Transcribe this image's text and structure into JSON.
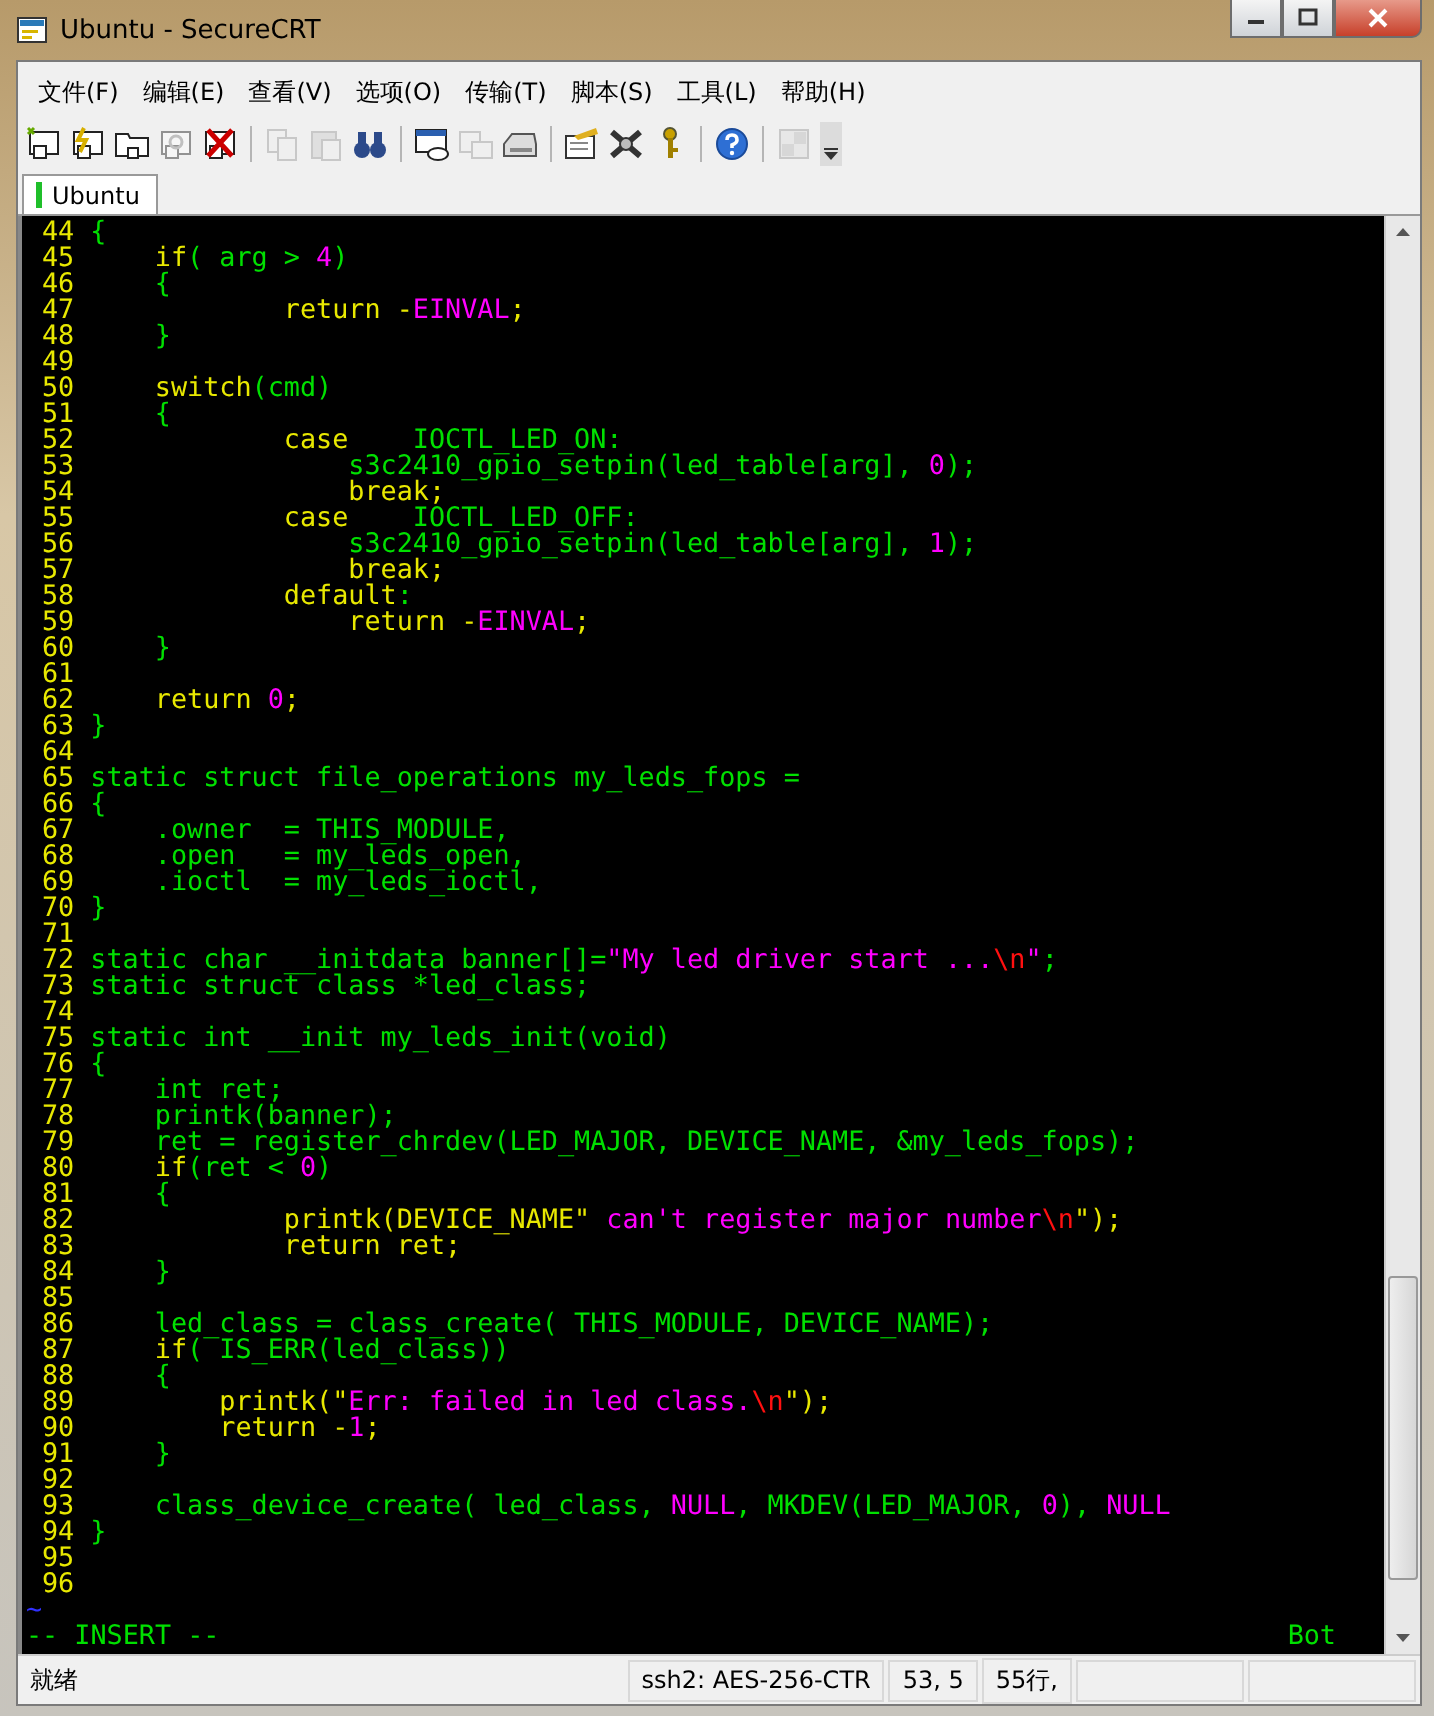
{
  "window": {
    "title": "Ubuntu - SecureCRT"
  },
  "menu": [
    "文件(F)",
    "编辑(E)",
    "查看(V)",
    "选项(O)",
    "传输(T)",
    "脚本(S)",
    "工具(L)",
    "帮助(H)"
  ],
  "toolbar": [
    {
      "kind": "connect",
      "disabled": false
    },
    {
      "kind": "quick-connect",
      "disabled": false
    },
    {
      "kind": "folder",
      "disabled": false
    },
    {
      "kind": "reconnect",
      "disabled": true
    },
    {
      "kind": "disconnect",
      "disabled": false
    },
    {
      "kind": "sep"
    },
    {
      "kind": "copy",
      "disabled": true
    },
    {
      "kind": "paste",
      "disabled": true
    },
    {
      "kind": "find",
      "disabled": false
    },
    {
      "kind": "sep"
    },
    {
      "kind": "window",
      "disabled": false
    },
    {
      "kind": "log",
      "disabled": true
    },
    {
      "kind": "print",
      "disabled": false
    },
    {
      "kind": "sep"
    },
    {
      "kind": "options",
      "disabled": false
    },
    {
      "kind": "tools",
      "disabled": false
    },
    {
      "kind": "key",
      "disabled": false
    },
    {
      "kind": "sep"
    },
    {
      "kind": "help",
      "disabled": false
    },
    {
      "kind": "sep"
    },
    {
      "kind": "map",
      "disabled": true
    }
  ],
  "tabs": [
    {
      "label": "Ubuntu",
      "selected": true,
      "connected": true
    }
  ],
  "terminal": {
    "lines": [
      {
        "number": "44",
        "spans": [
          {
            "kind": "code",
            "text": "{"
          }
        ]
      },
      {
        "number": "45",
        "spans": [
          {
            "kind": "keyword",
            "text": "    if"
          },
          {
            "kind": "code",
            "text": "( arg > "
          },
          {
            "kind": "constant",
            "text": "4"
          },
          {
            "kind": "code",
            "text": ")"
          }
        ]
      },
      {
        "number": "46",
        "spans": [
          {
            "kind": "code",
            "text": "    {"
          }
        ]
      },
      {
        "number": "47",
        "spans": [
          {
            "kind": "keyword",
            "text": "            return -"
          },
          {
            "kind": "constant",
            "text": "EINVAL"
          },
          {
            "kind": "keyword",
            "text": ";"
          }
        ]
      },
      {
        "number": "48",
        "spans": [
          {
            "kind": "code",
            "text": "    }"
          }
        ]
      },
      {
        "number": "49"
      },
      {
        "number": "50",
        "spans": [
          {
            "kind": "keyword",
            "text": "    switch"
          },
          {
            "kind": "code",
            "text": "(cmd)"
          }
        ]
      },
      {
        "number": "51",
        "spans": [
          {
            "kind": "code",
            "text": "    {"
          }
        ]
      },
      {
        "number": "52",
        "spans": [
          {
            "kind": "keyword",
            "text": "            case"
          },
          {
            "kind": "code",
            "text": "    IOCTL_LED_ON:"
          }
        ]
      },
      {
        "number": "53",
        "spans": [
          {
            "kind": "code",
            "text": "                s3c2410_gpio_setpin(led_table[arg], "
          },
          {
            "kind": "constant",
            "text": "0"
          },
          {
            "kind": "code",
            "text": ");"
          }
        ]
      },
      {
        "number": "54",
        "spans": [
          {
            "kind": "keyword",
            "text": "                break;"
          }
        ]
      },
      {
        "number": "55",
        "spans": [
          {
            "kind": "keyword",
            "text": "            case"
          },
          {
            "kind": "code",
            "text": "    IOCTL_LED_OFF:"
          }
        ]
      },
      {
        "number": "56",
        "spans": [
          {
            "kind": "code",
            "text": "                s3c2410_gpio_setpin(led_table[arg], "
          },
          {
            "kind": "constant",
            "text": "1"
          },
          {
            "kind": "code",
            "text": ");"
          }
        ]
      },
      {
        "number": "57",
        "spans": [
          {
            "kind": "keyword",
            "text": "                break;"
          }
        ]
      },
      {
        "number": "58",
        "spans": [
          {
            "kind": "keyword",
            "text": "            default"
          },
          {
            "kind": "code",
            "text": ":"
          }
        ]
      },
      {
        "number": "59",
        "spans": [
          {
            "kind": "keyword",
            "text": "                return -"
          },
          {
            "kind": "constant",
            "text": "EINVAL"
          },
          {
            "kind": "keyword",
            "text": ";"
          }
        ]
      },
      {
        "number": "60",
        "spans": [
          {
            "kind": "code",
            "text": "    }"
          }
        ]
      },
      {
        "number": "61"
      },
      {
        "number": "62",
        "spans": [
          {
            "kind": "keyword",
            "text": "    return "
          },
          {
            "kind": "constant",
            "text": "0"
          },
          {
            "kind": "keyword",
            "text": ";"
          }
        ]
      },
      {
        "number": "63",
        "spans": [
          {
            "kind": "code",
            "text": "}"
          }
        ]
      },
      {
        "number": "64"
      },
      {
        "number": "65",
        "spans": [
          {
            "kind": "code",
            "text": "static struct file_operations my_leds_fops ="
          }
        ]
      },
      {
        "number": "66",
        "spans": [
          {
            "kind": "code",
            "text": "{"
          }
        ]
      },
      {
        "number": "67",
        "spans": [
          {
            "kind": "code",
            "text": "    .owner  = THIS_MODULE,"
          }
        ]
      },
      {
        "number": "68",
        "spans": [
          {
            "kind": "code",
            "text": "    .open   = my_leds_open,"
          }
        ]
      },
      {
        "number": "69",
        "spans": [
          {
            "kind": "code",
            "text": "    .ioctl  = my_leds_ioctl,"
          }
        ]
      },
      {
        "number": "70",
        "spans": [
          {
            "kind": "code",
            "text": "}"
          }
        ]
      },
      {
        "number": "71"
      },
      {
        "number": "72",
        "spans": [
          {
            "kind": "code",
            "text": "static char __initdata banner[]="
          },
          {
            "kind": "constant",
            "text": "\"My led driver start ..."
          },
          {
            "kind": "escape",
            "text": "\\n"
          },
          {
            "kind": "constant",
            "text": "\""
          },
          {
            "kind": "code",
            "text": ";"
          }
        ]
      },
      {
        "number": "73",
        "spans": [
          {
            "kind": "code",
            "text": "static struct class *led_class;"
          }
        ]
      },
      {
        "number": "74"
      },
      {
        "number": "75",
        "spans": [
          {
            "kind": "code",
            "text": "static int __init my_leds_init(void)"
          }
        ]
      },
      {
        "number": "76",
        "spans": [
          {
            "kind": "code",
            "text": "{"
          }
        ]
      },
      {
        "number": "77",
        "spans": [
          {
            "kind": "code",
            "text": "    int ret;"
          }
        ]
      },
      {
        "number": "78",
        "spans": [
          {
            "kind": "code",
            "text": "    printk(banner);"
          }
        ]
      },
      {
        "number": "79",
        "spans": [
          {
            "kind": "code",
            "text": "    ret = register_chrdev(LED_MAJOR, DEVICE_NAME, &my_leds_fops);"
          }
        ]
      },
      {
        "number": "80",
        "spans": [
          {
            "kind": "keyword",
            "text": "    if"
          },
          {
            "kind": "code",
            "text": "(ret < "
          },
          {
            "kind": "constant",
            "text": "0"
          },
          {
            "kind": "code",
            "text": ")"
          }
        ]
      },
      {
        "number": "81",
        "spans": [
          {
            "kind": "code",
            "text": "    {"
          }
        ]
      },
      {
        "number": "82",
        "spans": [
          {
            "kind": "keyword",
            "text": "            printk(DEVICE_NAME\""
          },
          {
            "kind": "constant",
            "text": " can't register major number"
          },
          {
            "kind": "escape",
            "text": "\\n"
          },
          {
            "kind": "keyword",
            "text": "\");"
          }
        ]
      },
      {
        "number": "83",
        "spans": [
          {
            "kind": "keyword",
            "text": "            return ret;"
          }
        ]
      },
      {
        "number": "84",
        "spans": [
          {
            "kind": "code",
            "text": "    }"
          }
        ]
      },
      {
        "number": "85"
      },
      {
        "number": "86",
        "spans": [
          {
            "kind": "code",
            "text": "    led_class = class_create( THIS_MODULE, DEVICE_NAME);"
          }
        ]
      },
      {
        "number": "87",
        "spans": [
          {
            "kind": "keyword",
            "text": "    if"
          },
          {
            "kind": "code",
            "text": "( IS_ERR(led_class))"
          }
        ]
      },
      {
        "number": "88",
        "spans": [
          {
            "kind": "code",
            "text": "    {"
          }
        ]
      },
      {
        "number": "89",
        "spans": [
          {
            "kind": "keyword",
            "text": "        printk(\""
          },
          {
            "kind": "constant",
            "text": "Err: failed in led class."
          },
          {
            "kind": "escape",
            "text": "\\n"
          },
          {
            "kind": "keyword",
            "text": "\");"
          }
        ]
      },
      {
        "number": "90",
        "spans": [
          {
            "kind": "keyword",
            "text": "        return -"
          },
          {
            "kind": "constant",
            "text": "1"
          },
          {
            "kind": "keyword",
            "text": ";"
          }
        ]
      },
      {
        "number": "91",
        "spans": [
          {
            "kind": "code",
            "text": "    }"
          }
        ]
      },
      {
        "number": "92"
      },
      {
        "number": "93",
        "spans": [
          {
            "kind": "code",
            "text": "    class_device_create( led_class, "
          },
          {
            "kind": "constant",
            "text": "NULL"
          },
          {
            "kind": "code",
            "text": ", MKDEV(LED_MAJOR, "
          },
          {
            "kind": "constant",
            "text": "0"
          },
          {
            "kind": "code",
            "text": "), "
          },
          {
            "kind": "constant",
            "text": "NULL"
          }
        ]
      },
      {
        "number": "94",
        "spans": [
          {
            "kind": "code",
            "text": "}"
          }
        ]
      },
      {
        "number": "95"
      },
      {
        "number": "96"
      }
    ],
    "tilde": "~",
    "mode": "-- INSERT --",
    "position": "Bot"
  },
  "status_bar": {
    "message": "就绪",
    "panels": [
      "ssh2: AES-256-CTR",
      "53,  5",
      "55行,"
    ]
  }
}
